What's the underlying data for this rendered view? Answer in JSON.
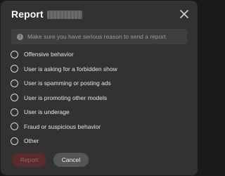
{
  "dialog": {
    "title": "Report",
    "close_icon": "close-icon",
    "notice": {
      "icon": "exclamation-circle-icon",
      "icon_glyph": "!",
      "text": "Make sure you have serious reason to send a report."
    },
    "options": [
      {
        "label": "Offensive behavior",
        "selected": false
      },
      {
        "label": "User is asking for a forbidden show",
        "selected": false
      },
      {
        "label": "User is spamming or posting ads",
        "selected": false
      },
      {
        "label": "User is promoting other models",
        "selected": false
      },
      {
        "label": "User is underage",
        "selected": false
      },
      {
        "label": "Fraud or suspicious behavior",
        "selected": false
      },
      {
        "label": "Other",
        "selected": false
      }
    ],
    "buttons": {
      "report_label": "Report",
      "cancel_label": "Cancel"
    },
    "colors": {
      "background": "#323232",
      "report_button": "#5a2b2e",
      "cancel_button": "#555555"
    }
  }
}
